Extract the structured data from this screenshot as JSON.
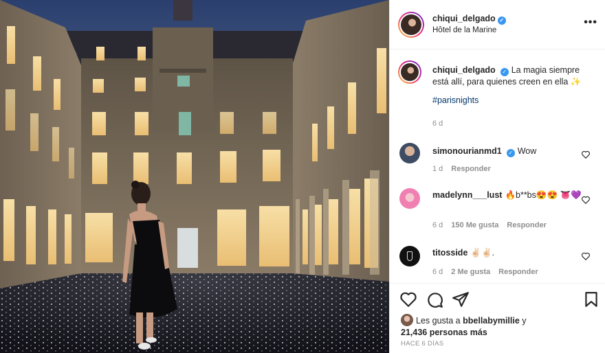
{
  "post": {
    "username": "chiqui_delgado",
    "location": "Hôtel de la Marine",
    "caption_user": "chiqui_delgado",
    "caption_text": "La magia siempre está allí, para quienes creen en ella ✨",
    "hashtag": "#parisnights",
    "caption_age": "6 d",
    "more_icon": "•••"
  },
  "comments": [
    {
      "user": "simonourianmd1",
      "verified": true,
      "text": "Wow",
      "age": "1 d",
      "likes": "",
      "reply": "Responder"
    },
    {
      "user": "madelynn___lust",
      "verified": false,
      "text": "🔥b**bs😍😍 👅💜",
      "age": "6 d",
      "likes": "150 Me gusta",
      "reply": "Responder"
    },
    {
      "user": "titosside",
      "verified": false,
      "text": "✌🏻✌🏻.",
      "age": "6 d",
      "likes": "2 Me gusta",
      "reply": "Responder"
    }
  ],
  "likes": {
    "prefix": "Les gusta a",
    "first_user": "bbellabymillie",
    "connector": "y",
    "others": "21,436 personas más"
  },
  "date": "HACE 6 DÍAS",
  "icons": [
    "heart-icon",
    "comment-icon",
    "share-icon",
    "bookmark-icon",
    "verified-icon",
    "more-icon"
  ],
  "colors": {
    "verified": "#3897f0",
    "hashtag": "#00376b",
    "muted": "#8e8e8e",
    "text": "#262626"
  }
}
